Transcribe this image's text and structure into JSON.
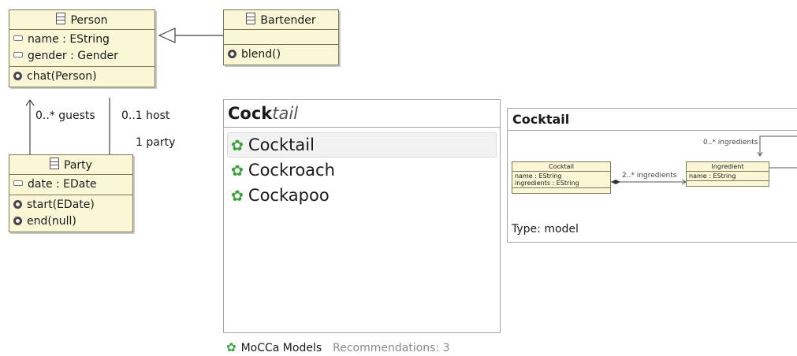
{
  "uml": {
    "person": {
      "name": "Person",
      "attributes": [
        "name : EString",
        "gender : Gender"
      ],
      "operations": [
        "chat(Person)"
      ]
    },
    "bartender": {
      "name": "Bartender",
      "operations": [
        "blend()"
      ]
    },
    "party": {
      "name": "Party",
      "attributes": [
        "date : EDate"
      ],
      "operations": [
        "start(EDate)",
        "end(null)"
      ]
    },
    "labels": {
      "guests": "0..* guests",
      "host": "0..1 host",
      "party": "1 party"
    }
  },
  "search": {
    "query_typed": "Cock",
    "query_completion": "tail",
    "results": [
      "Cocktail",
      "Cockroach",
      "Cockapoo"
    ]
  },
  "footer": {
    "title": "MoCCa Models",
    "recommendations": "Recommendations: 3"
  },
  "preview": {
    "title": "Cocktail",
    "cocktail_class": {
      "name": "Cocktail",
      "attributes": [
        "name : EString",
        "ingredients : EString"
      ]
    },
    "ingredient_class": {
      "name": "Ingredient",
      "attributes": [
        "name : EString"
      ]
    },
    "assoc_label": "2..* ingredients",
    "self_label": "0..* ingredients",
    "type": "Type: model"
  },
  "colors": {
    "class_fill": "#fbf7d6",
    "class_border": "#7a7a57",
    "mocca_green": "#3aa23a"
  }
}
